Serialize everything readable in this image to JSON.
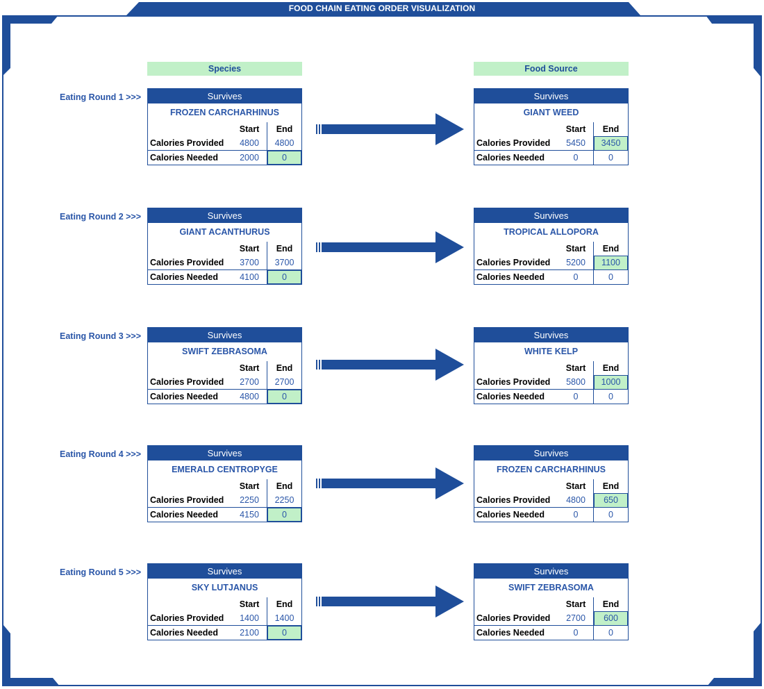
{
  "title": "FOOD CHAIN EATING ORDER VISUALIZATION",
  "columns": {
    "species": "Species",
    "food_source": "Food Source"
  },
  "labels": {
    "status": "Survives",
    "start": "Start",
    "end": "End",
    "calories_provided": "Calories Provided",
    "calories_needed": "Calories Needed"
  },
  "colors": {
    "accent": "#1f4e9a",
    "highlight": "#c1f0c8",
    "value_text": "#2a56a8"
  },
  "rounds": [
    {
      "label": "Eating Round 1 >>>",
      "species": {
        "status": "Survives",
        "name": "FROZEN CARCHARHINUS",
        "provided_start": "4800",
        "provided_end": "4800",
        "needed_start": "2000",
        "needed_end": "0"
      },
      "food": {
        "status": "Survives",
        "name": "GIANT WEED",
        "provided_start": "5450",
        "provided_end": "3450",
        "needed_start": "0",
        "needed_end": "0"
      }
    },
    {
      "label": "Eating Round 2 >>>",
      "species": {
        "status": "Survives",
        "name": "GIANT ACANTHURUS",
        "provided_start": "3700",
        "provided_end": "3700",
        "needed_start": "4100",
        "needed_end": "0"
      },
      "food": {
        "status": "Survives",
        "name": "TROPICAL ALLOPORA",
        "provided_start": "5200",
        "provided_end": "1100",
        "needed_start": "0",
        "needed_end": "0"
      }
    },
    {
      "label": "Eating Round 3 >>>",
      "species": {
        "status": "Survives",
        "name": "SWIFT ZEBRASOMA",
        "provided_start": "2700",
        "provided_end": "2700",
        "needed_start": "4800",
        "needed_end": "0"
      },
      "food": {
        "status": "Survives",
        "name": "WHITE KELP",
        "provided_start": "5800",
        "provided_end": "1000",
        "needed_start": "0",
        "needed_end": "0"
      }
    },
    {
      "label": "Eating Round 4 >>>",
      "species": {
        "status": "Survives",
        "name": "EMERALD CENTROPYGE",
        "provided_start": "2250",
        "provided_end": "2250",
        "needed_start": "4150",
        "needed_end": "0"
      },
      "food": {
        "status": "Survives",
        "name": "FROZEN CARCHARHINUS",
        "provided_start": "4800",
        "provided_end": "650",
        "needed_start": "0",
        "needed_end": "0"
      }
    },
    {
      "label": "Eating Round 5 >>>",
      "species": {
        "status": "Survives",
        "name": "SKY LUTJANUS",
        "provided_start": "1400",
        "provided_end": "1400",
        "needed_start": "2100",
        "needed_end": "0"
      },
      "food": {
        "status": "Survives",
        "name": "SWIFT ZEBRASOMA",
        "provided_start": "2700",
        "provided_end": "600",
        "needed_start": "0",
        "needed_end": "0"
      }
    }
  ]
}
